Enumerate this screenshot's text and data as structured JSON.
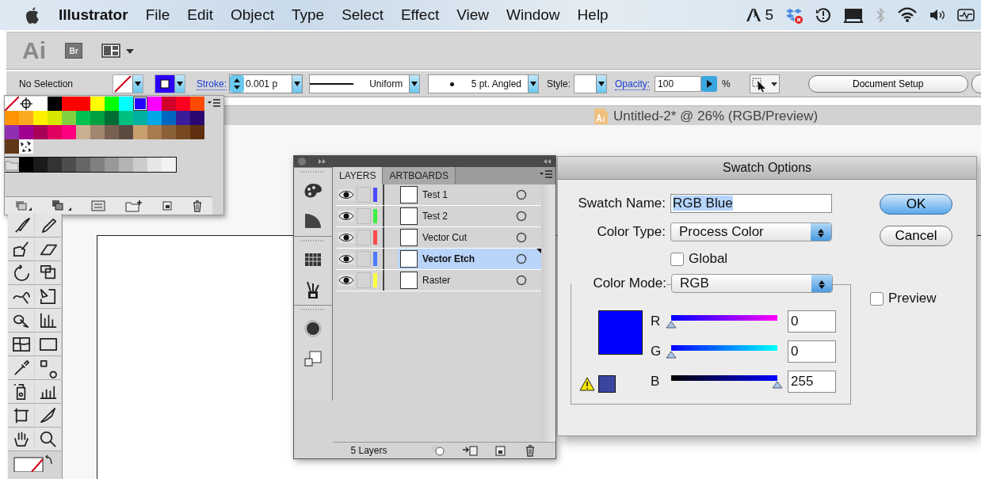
{
  "menu_bar": {
    "app": "Illustrator",
    "items": [
      "File",
      "Edit",
      "Object",
      "Type",
      "Select",
      "Effect",
      "View",
      "Window",
      "Help"
    ],
    "adobe_count": "5"
  },
  "app_bar": {
    "logo": "Ai",
    "bridge": "Br"
  },
  "control_bar": {
    "selection": "No Selection",
    "stroke_label": "Stroke:",
    "stroke_weight": "0.001 p",
    "profile": "Uniform",
    "brush": "5 pt. Angled",
    "style_label": "Style:",
    "opacity_label": "Opacity:",
    "opacity": "100",
    "percent": "%",
    "document_setup": "Document Setup"
  },
  "document": {
    "title": "Untitled-2* @ 26% (RGB/Preview)"
  },
  "swatches": {
    "rows": [
      [
        {
          "kind": "none",
          "selected": false
        },
        {
          "kind": "registration",
          "selected": false
        },
        {
          "kind": "color",
          "color": "#ffffff",
          "selected": false
        },
        {
          "kind": "color",
          "color": "#000000",
          "selected": false
        },
        {
          "kind": "color",
          "color": "#ff0000",
          "selected": false
        },
        {
          "kind": "color",
          "color": "#fe0000",
          "selected": false
        },
        {
          "kind": "color",
          "color": "#ffff00",
          "selected": false
        },
        {
          "kind": "color",
          "color": "#00ff00",
          "selected": false
        },
        {
          "kind": "color",
          "color": "#00ffff",
          "selected": false
        },
        {
          "kind": "color",
          "color": "#2200ff",
          "selected": true
        },
        {
          "kind": "color",
          "color": "#ff00ff",
          "selected": false
        },
        {
          "kind": "color",
          "color": "#d0002a",
          "selected": false
        },
        {
          "kind": "color",
          "color": "#ff0020",
          "selected": false
        },
        {
          "kind": "color",
          "color": "#ff4a00",
          "selected": false
        }
      ],
      [
        {
          "kind": "color",
          "color": "#ff9400",
          "selected": false
        },
        {
          "kind": "color",
          "color": "#fbaa20",
          "selected": false
        },
        {
          "kind": "color",
          "color": "#fff000",
          "selected": false
        },
        {
          "kind": "color",
          "color": "#d8e800",
          "selected": false
        },
        {
          "kind": "color",
          "color": "#80d040",
          "selected": false
        },
        {
          "kind": "color",
          "color": "#00c050",
          "selected": false
        },
        {
          "kind": "color",
          "color": "#00a040",
          "selected": false
        },
        {
          "kind": "color",
          "color": "#006b35",
          "selected": false
        },
        {
          "kind": "color",
          "color": "#00c080",
          "selected": false
        },
        {
          "kind": "color",
          "color": "#00b0a0",
          "selected": false
        },
        {
          "kind": "color",
          "color": "#00a8e8",
          "selected": false
        },
        {
          "kind": "color",
          "color": "#0068c0",
          "selected": false
        },
        {
          "kind": "color",
          "color": "#3a1b9a",
          "selected": false
        },
        {
          "kind": "color",
          "color": "#2a0870",
          "selected": false
        }
      ],
      [
        {
          "kind": "color",
          "color": "#9030b0",
          "selected": false
        },
        {
          "kind": "color",
          "color": "#a0008f",
          "selected": false
        },
        {
          "kind": "color",
          "color": "#a80058",
          "selected": false
        },
        {
          "kind": "color",
          "color": "#e00060",
          "selected": false
        },
        {
          "kind": "color",
          "color": "#ff0080",
          "selected": false
        },
        {
          "kind": "color",
          "color": "#c8b090",
          "selected": false
        },
        {
          "kind": "color",
          "color": "#a08870",
          "selected": false
        },
        {
          "kind": "color",
          "color": "#786050",
          "selected": false
        },
        {
          "kind": "color",
          "color": "#5a4a40",
          "selected": false
        },
        {
          "kind": "color",
          "color": "#c8a070",
          "selected": false
        },
        {
          "kind": "color",
          "color": "#a87a50",
          "selected": false
        },
        {
          "kind": "color",
          "color": "#8a6038",
          "selected": false
        },
        {
          "kind": "color",
          "color": "#784820",
          "selected": false
        },
        {
          "kind": "color",
          "color": "#603010",
          "selected": false
        }
      ],
      [
        {
          "kind": "color",
          "color": "#603818",
          "selected": false
        },
        {
          "kind": "pattern",
          "selected": false
        }
      ],
      [
        {
          "kind": "folder",
          "selected": false
        },
        {
          "kind": "color",
          "color": "#000001",
          "selected": false
        },
        {
          "kind": "color",
          "color": "#1a1a1a",
          "selected": false
        },
        {
          "kind": "color",
          "color": "#333333",
          "selected": false
        },
        {
          "kind": "color",
          "color": "#4d4d4d",
          "selected": false
        },
        {
          "kind": "color",
          "color": "#666666",
          "selected": false
        },
        {
          "kind": "color",
          "color": "#808080",
          "selected": false
        },
        {
          "kind": "color",
          "color": "#999999",
          "selected": false
        },
        {
          "kind": "color",
          "color": "#b3b3b3",
          "selected": false
        },
        {
          "kind": "color",
          "color": "#cccccc",
          "selected": false
        },
        {
          "kind": "color",
          "color": "#e6e6e6",
          "selected": false
        },
        {
          "kind": "color",
          "color": "#f2f2f2",
          "selected": false
        }
      ]
    ]
  },
  "layers_panel": {
    "tabs": [
      {
        "label": "LAYERS",
        "selected": true
      },
      {
        "label": "ARTBOARDS",
        "selected": false
      }
    ],
    "layers": [
      {
        "name": "Test 1",
        "color": "#4a4aff",
        "visible": true,
        "selected": false
      },
      {
        "name": "Test 2",
        "color": "#40f040",
        "visible": true,
        "selected": false
      },
      {
        "name": "Vector Cut",
        "color": "#ff4a4a",
        "visible": true,
        "selected": false
      },
      {
        "name": "Vector Etch",
        "color": "#4a7aff",
        "visible": true,
        "selected": true
      },
      {
        "name": "Raster",
        "color": "#ffff40",
        "visible": true,
        "selected": false
      }
    ],
    "count": "5 Layers"
  },
  "swatch_options": {
    "title": "Swatch Options",
    "name_label": "Swatch Name:",
    "name_value": "RGB Blue",
    "type_label": "Color Type:",
    "type_value": "Process Color",
    "global_label": "Global",
    "global": false,
    "mode_label": "Color Mode:",
    "mode_value": "RGB",
    "preview_label": "Preview",
    "preview": false,
    "channels": [
      {
        "label": "R",
        "level": 0,
        "value": "0"
      },
      {
        "label": "G",
        "level": 0,
        "value": "0"
      },
      {
        "label": "B",
        "level": 1,
        "value": "255"
      }
    ],
    "ok": "OK",
    "cancel": "Cancel"
  }
}
